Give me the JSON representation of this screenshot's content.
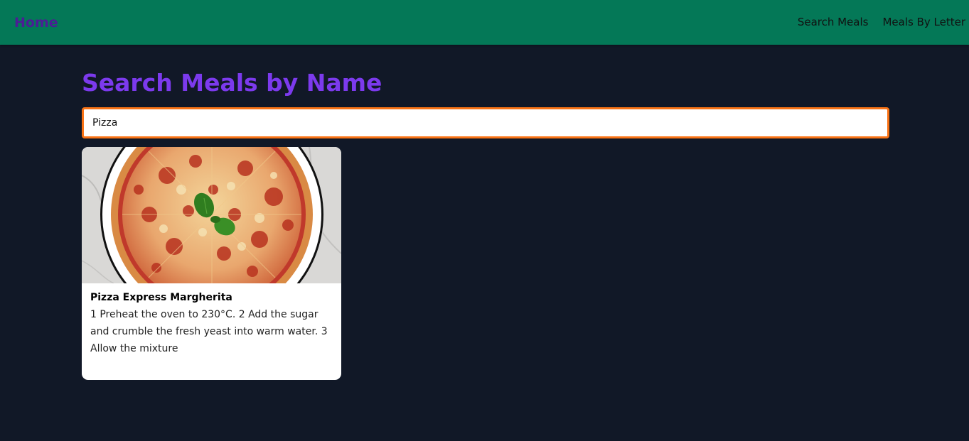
{
  "nav": {
    "home_label": "Home",
    "links": [
      "Search Meals",
      "Meals By Letter"
    ]
  },
  "page": {
    "title": "Search Meals by Name"
  },
  "search": {
    "value": "Pizza"
  },
  "results": [
    {
      "name": "Pizza Express Margherita",
      "description": "1 Preheat the oven to 230°C. 2 Add the sugar and crumble the fresh yeast into warm water. 3 Allow the mixture",
      "image": "pizza-margherita-photo"
    }
  ],
  "colors": {
    "navbar_bg": "#047857",
    "page_bg": "#111827",
    "title": "#7c3aed",
    "home_link": "#4c1d95",
    "search_border": "#f97316"
  }
}
